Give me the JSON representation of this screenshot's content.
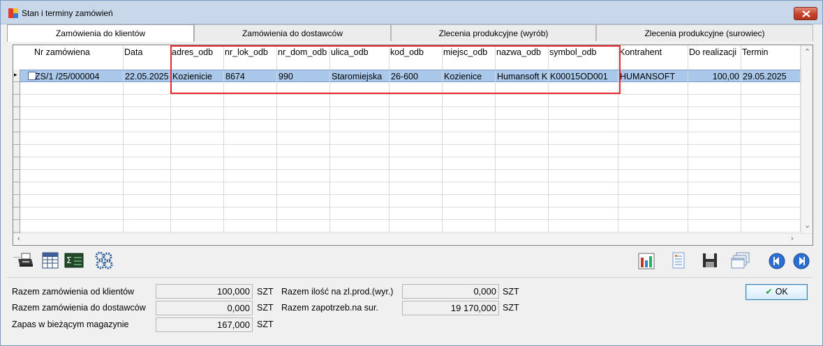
{
  "window": {
    "title": "Stan i terminy zamówień"
  },
  "tabs": [
    {
      "label": "Zamówienia do klientów",
      "active": true
    },
    {
      "label": "Zamówienia do dostawców",
      "active": false
    },
    {
      "label": "Zlecenia produkcyjne (wyrób)",
      "active": false
    },
    {
      "label": "Zlecenia produkcyjne (surowiec)",
      "active": false
    }
  ],
  "grid": {
    "columns": [
      "Nr zamówiena",
      "Data",
      "adres_odb",
      "nr_lok_odb",
      "nr_dom_odb",
      "ulica_odb",
      "kod_odb",
      "miejsc_odb",
      "nazwa_odb",
      "symbol_odb",
      "Kontrahent",
      "Do realizacji",
      "Termin"
    ],
    "rows": [
      [
        "ZS/1  /25/000004",
        "22.05.2025",
        "Kozienicie",
        "8674",
        "990",
        "Staromiejska",
        "26-600",
        "Kozienice",
        "Humansoft K",
        "K00015OD001",
        "HUMANSOFT",
        "100,00",
        "29.05.2025"
      ]
    ],
    "highlight_color": "#e8262b"
  },
  "toolbar_left": [
    "printer-icon",
    "table-calculator-icon",
    "sum-icon",
    "gears-icon"
  ],
  "toolbar_right": [
    "chart-icon",
    "sheet-icon",
    "save-icon",
    "windows-icon",
    "nav-prev-icon",
    "nav-next-icon"
  ],
  "summary": {
    "klienci": {
      "label": "Razem zamówienia od klientów",
      "value": "100,000",
      "unit": "SZT"
    },
    "dostawcy": {
      "label": "Razem zamówienia do dostawców",
      "value": "0,000",
      "unit": "SZT"
    },
    "zapas": {
      "label": "Zapas w bieżącym magazynie",
      "value": "167,000",
      "unit": "SZT"
    },
    "ilosc": {
      "label": "Razem ilość na zl.prod.(wyr.)",
      "value": "0,000",
      "unit": "SZT"
    },
    "zapotrzeb": {
      "label": "Razem zapotrzeb.na sur.",
      "value": "19 170,000",
      "unit": "SZT"
    }
  },
  "ok_button": {
    "label": "OK"
  }
}
